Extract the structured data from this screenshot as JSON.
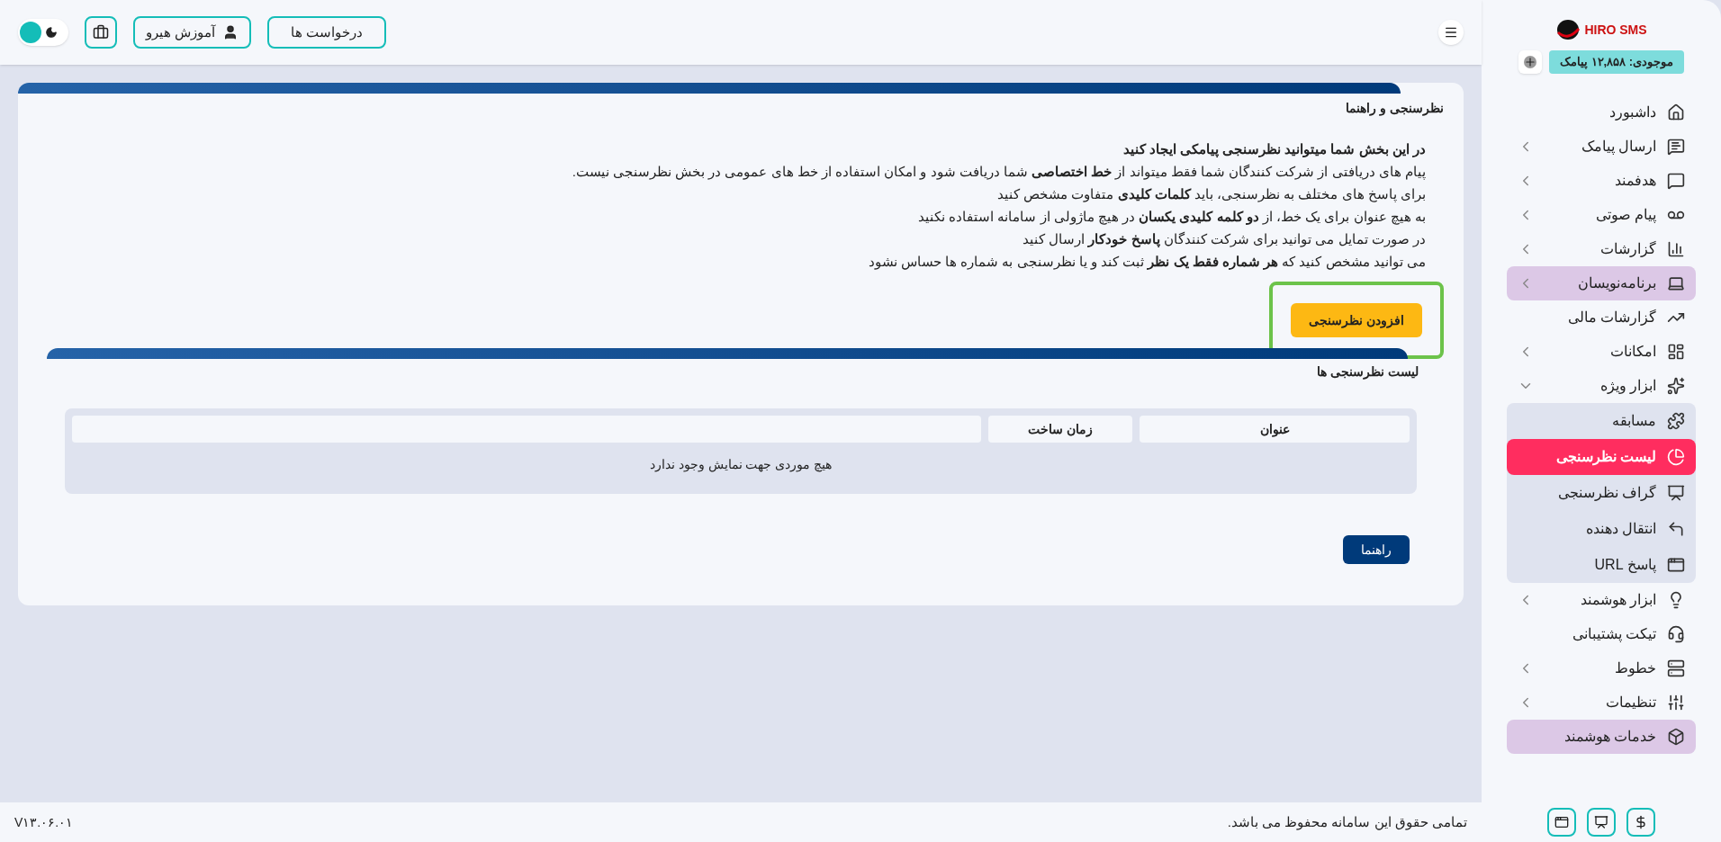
{
  "topbar": {
    "buttons": [
      {
        "label": "درخواست ها"
      },
      {
        "label": "آموزش هیرو"
      }
    ],
    "dark_mode": false
  },
  "sidebar": {
    "logo": "HIRO SMS",
    "balance": "موجودی: ۱۲,۸۵۸ پیامک",
    "items": [
      {
        "label": "داشبورد",
        "submenu": false,
        "highlighted": false,
        "selected": false
      },
      {
        "label": "ارسال پیامک",
        "submenu": true,
        "expanded": false,
        "highlighted": false,
        "selected": false
      },
      {
        "label": "هدفمند",
        "submenu": true,
        "expanded": false,
        "highlighted": false,
        "selected": false
      },
      {
        "label": "پیام صوتی",
        "submenu": true,
        "expanded": false,
        "highlighted": false,
        "selected": false
      },
      {
        "label": "گزارشات",
        "submenu": true,
        "expanded": false,
        "highlighted": false,
        "selected": false
      },
      {
        "label": "برنامه‌نویسان",
        "submenu": true,
        "expanded": false,
        "highlighted": true,
        "selected": false
      },
      {
        "label": "گزارشات مالی",
        "submenu": false,
        "highlighted": false,
        "selected": false
      },
      {
        "label": "امکانات",
        "submenu": true,
        "expanded": false,
        "highlighted": false,
        "selected": false
      },
      {
        "label": "ابزار ویژه",
        "submenu": true,
        "expanded": true,
        "highlighted": false,
        "selected": false,
        "children": [
          {
            "label": "مسابقه",
            "selected": false
          },
          {
            "label": "لیست نظرسنجی",
            "selected": true
          },
          {
            "label": "گراف نظرسنجی",
            "selected": false
          },
          {
            "label": "انتقال دهنده",
            "selected": false
          },
          {
            "label": "پاسخ URL",
            "selected": false
          }
        ]
      },
      {
        "label": "ابزار هوشمند",
        "submenu": true,
        "expanded": false,
        "highlighted": false,
        "selected": false
      },
      {
        "label": "تیکت پشتیبانی",
        "submenu": false,
        "highlighted": false,
        "selected": false
      },
      {
        "label": "خطوط",
        "submenu": true,
        "expanded": false,
        "highlighted": false,
        "selected": false
      },
      {
        "label": "تنظیمات",
        "submenu": true,
        "expanded": false,
        "highlighted": false,
        "selected": false
      },
      {
        "label": "خدمات هوشمند",
        "submenu": false,
        "highlighted": true,
        "selected": false
      }
    ]
  },
  "guide": {
    "title": "نظرسنجی و راهنما",
    "heading": "در این بخش شما میتوانید نظرسنجی پیامکی ایجاد کنید",
    "lines": [
      "پیام های دریافتی از شرکت کنندگان شما فقط میتواند از **خط اختصاصی** شما دریافت شود و امکان استفاده از خط های عمومی در بخش نظرسنجی نیست.",
      "برای پاسخ های مختلف به نظرسنجی، باید **کلمات کلیدی** متفاوت مشخص کنید",
      "به هیچ عنوان برای یک خط، از **دو کلمه کلیدی یکسان** در هیچ ماژولی از سامانه استفاده نکنید",
      "در صورت تمایل می توانید برای شرکت کنندگان **پاسخ خودکار** ارسال کنید",
      "می توانید مشخص کنید که **هر شماره فقط یک نظر** ثبت کند و یا نظرسنجی به شماره ها حساس نشود"
    ],
    "add_button": "افزودن نظرسنجی",
    "add_button_highlighted": true
  },
  "list": {
    "title": "لیست نظرسنجی ها",
    "columns": [
      "عنوان",
      "زمان ساخت"
    ],
    "empty_message": "هیچ موردی جهت نمایش وجود ندارد",
    "help_button": "راهنما"
  },
  "footer": {
    "copyright": "تمامی حقوق این سامانه محفوظ می باشد.",
    "version": "V۱۳.۰۶.۰۱"
  }
}
